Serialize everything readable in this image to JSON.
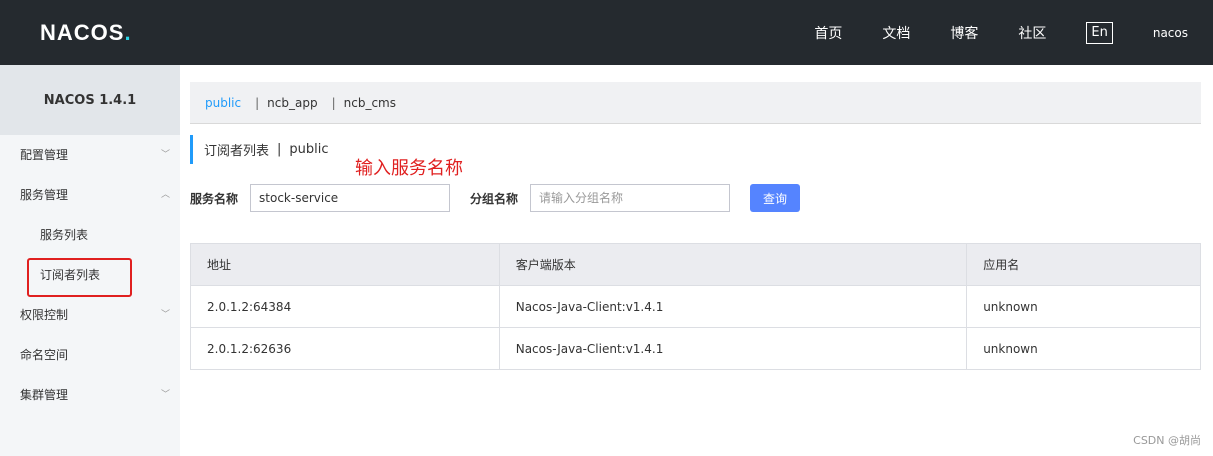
{
  "header": {
    "logo_text": "NACOS",
    "logo_dot": ".",
    "nav": [
      "首页",
      "文档",
      "博客",
      "社区"
    ],
    "lang_label": "En",
    "user": "nacos"
  },
  "sidebar": {
    "version": "NACOS 1.4.1",
    "items": [
      {
        "label": "配置管理",
        "chevron": "﹀"
      },
      {
        "label": "服务管理",
        "chevron": "︿"
      },
      {
        "label": "服务列表"
      },
      {
        "label": "订阅者列表"
      },
      {
        "label": "权限控制",
        "chevron": "﹀"
      },
      {
        "label": "命名空间"
      },
      {
        "label": "集群管理",
        "chevron": "﹀"
      }
    ]
  },
  "namespaces": [
    "public",
    "ncb_app",
    "ncb_cms"
  ],
  "page": {
    "title": "订阅者列表",
    "title_sep": "|",
    "namespace": "public",
    "annotation": "输入服务名称"
  },
  "search": {
    "service_label": "服务名称",
    "service_value": "stock-service",
    "group_label": "分组名称",
    "group_placeholder": "请输入分组名称",
    "query_button": "查询"
  },
  "table": {
    "headers": [
      "地址",
      "客户端版本",
      "应用名"
    ],
    "rows": [
      [
        "2.0.1.2:64384",
        "Nacos-Java-Client:v1.4.1",
        "unknown"
      ],
      [
        "2.0.1.2:62636",
        "Nacos-Java-Client:v1.4.1",
        "unknown"
      ]
    ]
  },
  "watermark": "CSDN @胡尚",
  "colors": {
    "accent": "#209bfa",
    "annotation": "#e02020",
    "header_bg": "#252a2f",
    "button": "#5584ff"
  }
}
